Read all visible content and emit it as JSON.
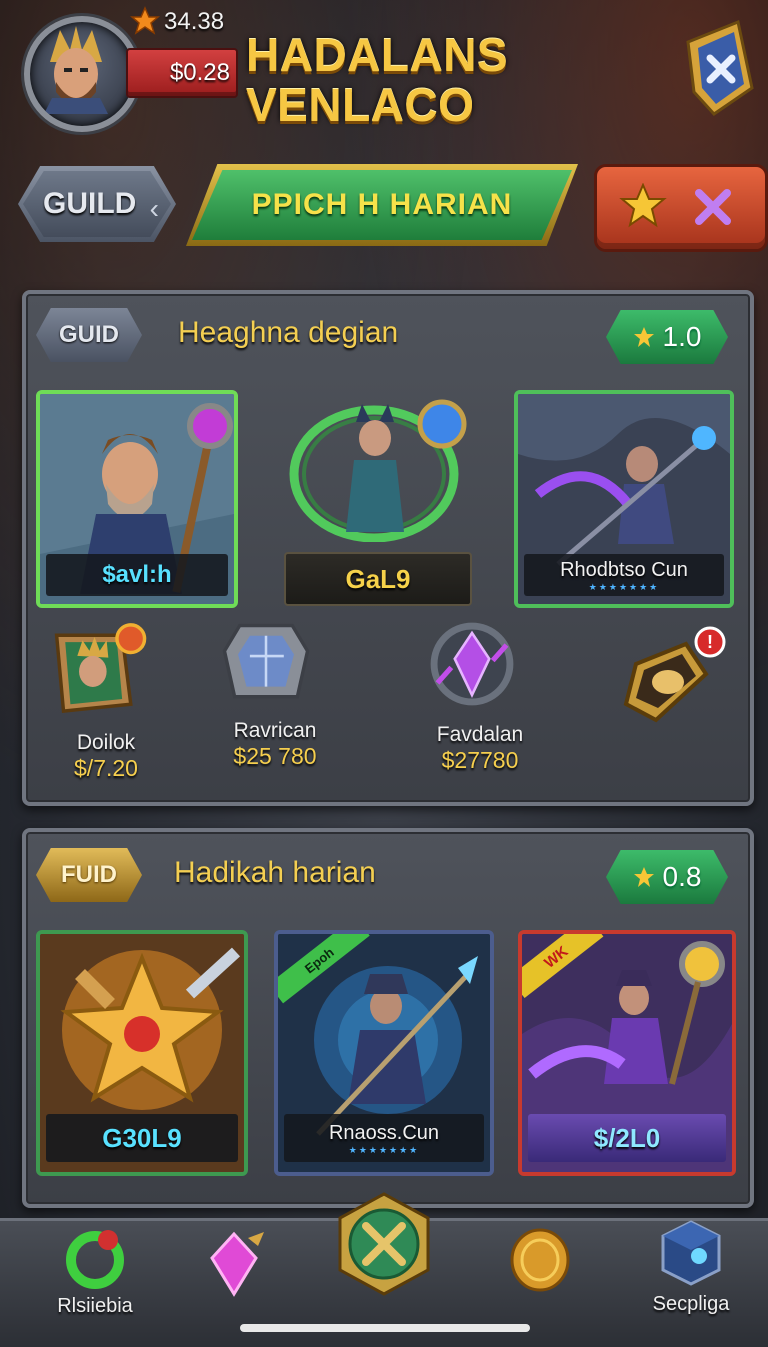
{
  "header": {
    "gold_amount": "34.38",
    "currency_amount": "$0.28",
    "title": "HADALANS VENLACO",
    "icons": {
      "avatar": "hero-portrait",
      "star": "star-icon",
      "shield": "shield-close-icon"
    }
  },
  "nav": {
    "guild_label": "GUILD",
    "daily_label": "PPICH H HARIAN",
    "action_icons": [
      "star-icon",
      "close-x-icon"
    ]
  },
  "panel1": {
    "tag": "GUID",
    "title": "Heaghna degian",
    "rating": "1.0",
    "cards": [
      {
        "caption": "$avl:h",
        "icon": "bearded-mage-hero",
        "border": "#6fdc57"
      },
      {
        "caption": "GaL9",
        "icon": "cat-warrior-hero",
        "border": "none"
      },
      {
        "caption": "Rhodbtso Cun",
        "icon": "shadow-spearman-hero",
        "border": "#4fbf5a",
        "stars": "★★★★★★★"
      }
    ],
    "items": [
      {
        "name": "Doilok",
        "price": "$/7.20",
        "icon": "hero-badge-icon"
      },
      {
        "name": "Ravrican",
        "price": "$25 780",
        "icon": "crystal-shield-icon"
      },
      {
        "name": "Favdalan",
        "price": "$27780",
        "icon": "purple-gem-icon"
      },
      {
        "name": "",
        "price": "",
        "icon": "gold-emblem-icon",
        "badge": "!"
      }
    ]
  },
  "panel2": {
    "tag": "FUID",
    "title": "Hadikah harian",
    "rating": "0.8",
    "cards": [
      {
        "caption": "G30L9",
        "icon": "golden-star-sword",
        "border": "#3e9950"
      },
      {
        "caption": "Rnaoss.Cun",
        "icon": "armored-spear-knight",
        "border": "#4c5d8e",
        "ribbon": "Epoh",
        "stars": "★★★★★★★"
      },
      {
        "caption": "$/2L0",
        "icon": "purple-mage-hero",
        "border": "#c83a2e",
        "ribbon": "WK"
      }
    ]
  },
  "bottom_bar": {
    "items": [
      {
        "label": "Rlsiiebia",
        "icon": "green-ring-icon"
      },
      {
        "label": "",
        "icon": "pink-crystal-icon"
      },
      {
        "label": "",
        "icon": "crossed-swords-icon"
      },
      {
        "label": "",
        "icon": "gold-coin-icon"
      },
      {
        "label": "Secpliga",
        "icon": "blue-cube-icon"
      }
    ]
  }
}
